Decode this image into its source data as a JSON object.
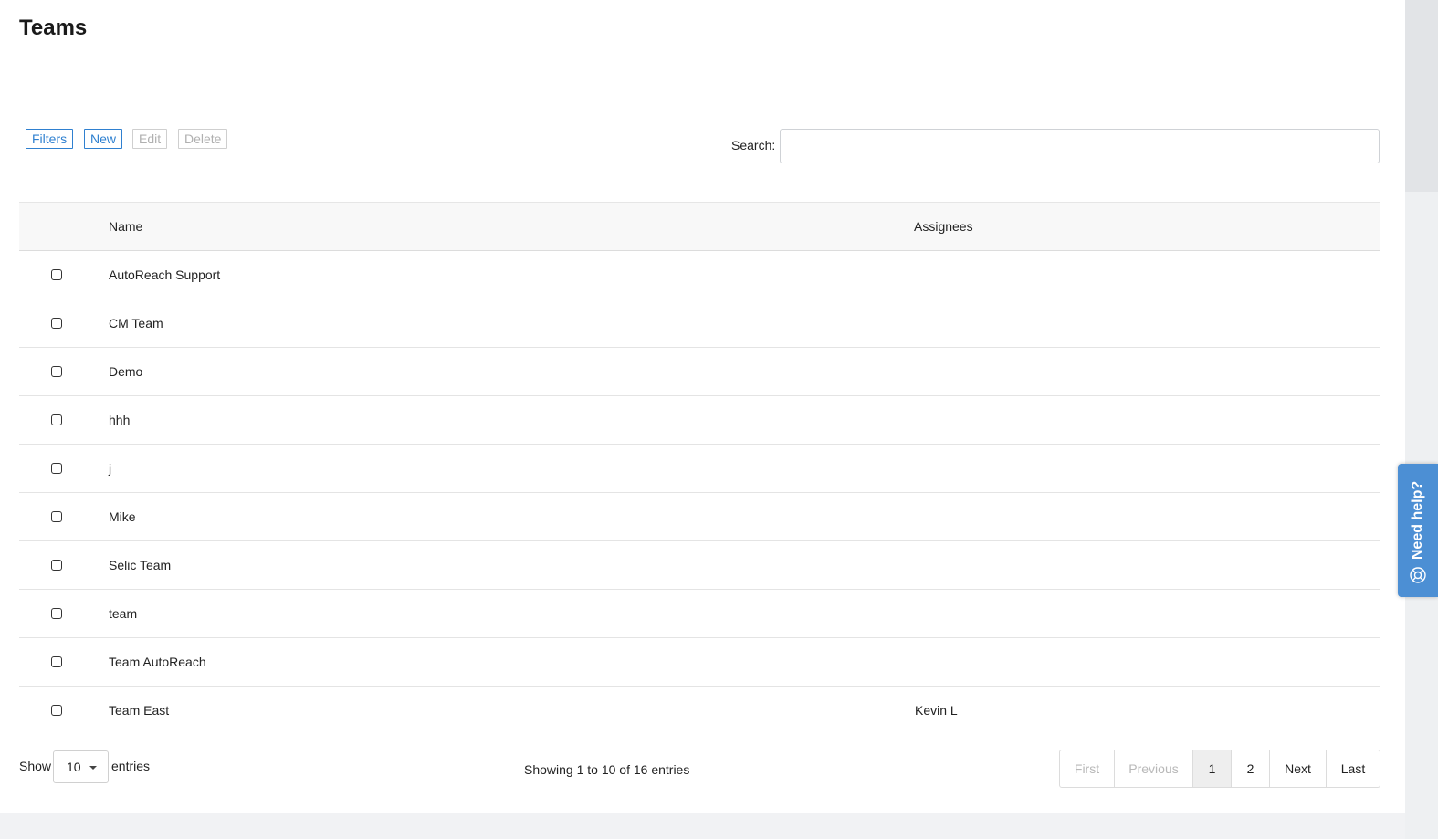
{
  "page": {
    "title": "Teams"
  },
  "toolbar": {
    "filters": "Filters",
    "new": "New",
    "edit": "Edit",
    "delete": "Delete"
  },
  "search": {
    "label": "Search:",
    "value": "",
    "placeholder": ""
  },
  "table": {
    "columns": [
      "Name",
      "Assignees"
    ],
    "rows": [
      {
        "name": "AutoReach Support",
        "assignees": ""
      },
      {
        "name": "CM Team",
        "assignees": ""
      },
      {
        "name": "Demo",
        "assignees": ""
      },
      {
        "name": "hhh",
        "assignees": ""
      },
      {
        "name": "j",
        "assignees": ""
      },
      {
        "name": "Mike",
        "assignees": ""
      },
      {
        "name": "Selic Team",
        "assignees": ""
      },
      {
        "name": "team",
        "assignees": ""
      },
      {
        "name": "Team AutoReach",
        "assignees": ""
      },
      {
        "name": "Team East",
        "assignees": "Kevin L"
      }
    ]
  },
  "footer": {
    "show_label": "Show",
    "page_length": "10",
    "entries_label": "entries",
    "info": "Showing 1 to 10 of 16 entries"
  },
  "pagination": {
    "first": "First",
    "previous": "Previous",
    "pages": [
      "1",
      "2"
    ],
    "current": "1",
    "next": "Next",
    "last": "Last"
  },
  "help": {
    "label": "Need help?"
  },
  "colors": {
    "accent": "#2f80d0",
    "help_tab": "#4c8fd4",
    "disabled": "#b0b0b0"
  }
}
